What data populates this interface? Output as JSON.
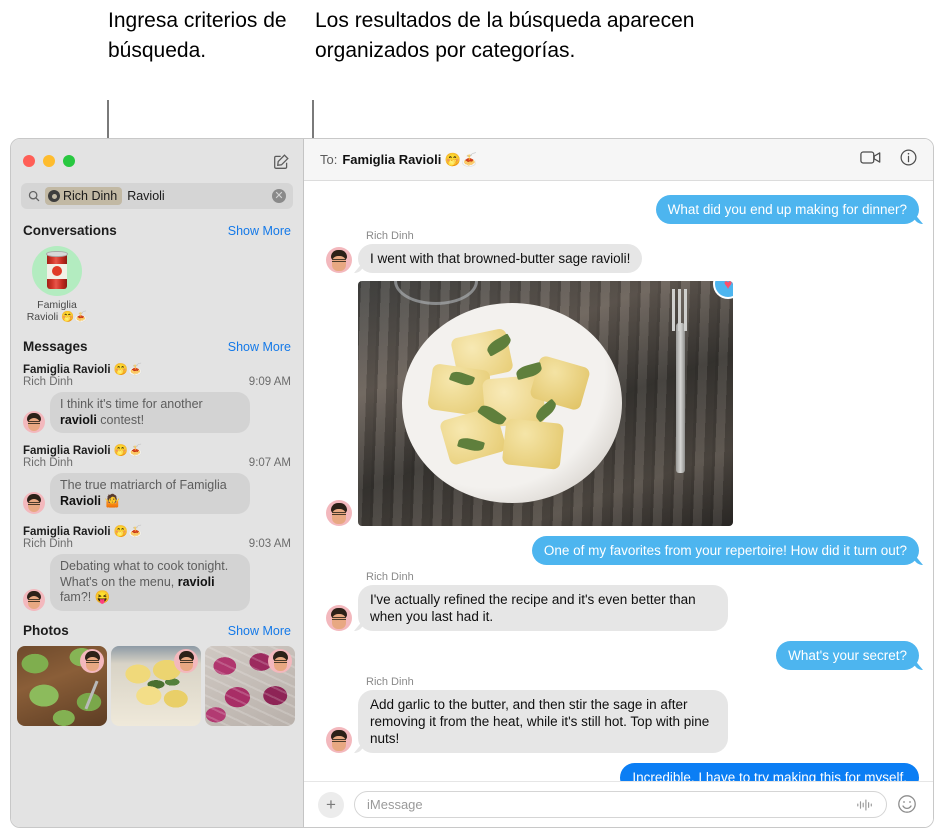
{
  "annotations": {
    "left": "Ingresa criterios de búsqueda.",
    "right": "Los resultados de la búsqueda aparecen organizados por categorías."
  },
  "sidebar": {
    "compose_icon": "compose-icon",
    "search": {
      "icon": "search-icon",
      "token_label": "Rich Dinh",
      "query_text": "Ravioli",
      "clear_icon": "clear-icon",
      "clear_glyph": "✕"
    },
    "sections": [
      {
        "title": "Conversations",
        "show_more": "Show More"
      },
      {
        "title": "Messages",
        "show_more": "Show More"
      },
      {
        "title": "Photos",
        "show_more": "Show More"
      }
    ],
    "conversations": [
      {
        "name": "Famiglia Ravioli 🤭🍝",
        "avatar_icon": "tomato-can-avatar"
      }
    ],
    "message_results": [
      {
        "chat": "Famiglia Ravioli 🤭🍝",
        "sender": "Rich Dinh",
        "time": "9:09 AM",
        "pre": "I think it's time for another ",
        "match": "ravioli",
        "post": " contest!"
      },
      {
        "chat": "Famiglia Ravioli 🤭🍝",
        "sender": "Rich Dinh",
        "time": "9:07 AM",
        "pre": "The true matriarch of Famiglia ",
        "match": "Ravioli",
        "post": " 🤷"
      },
      {
        "chat": "Famiglia Ravioli 🤭🍝",
        "sender": "Rich Dinh",
        "time": "9:03 AM",
        "pre": "Debating what to cook tonight. What's on the menu, ",
        "match": "ravioli",
        "post": " fam?! 😝"
      }
    ],
    "photos": [
      {
        "name": "spinach-ravioli-photo"
      },
      {
        "name": "sage-butter-ravioli-photo"
      },
      {
        "name": "beet-ravioli-photo"
      }
    ]
  },
  "conversation": {
    "to_label": "To:",
    "recipient": "Famiglia Ravioli 🤭🍝",
    "facetime_icon": "facetime-video-icon",
    "info_icon": "info-icon",
    "messages": [
      {
        "type": "outgoing",
        "text": "What did you end up making for dinner?",
        "style": "light"
      },
      {
        "type": "incoming",
        "sender": "Rich Dinh",
        "text": "I went with that browned-butter sage ravioli!"
      },
      {
        "type": "photo",
        "alt": "ravioli-with-sage-photo",
        "tapback": "heart-tapback"
      },
      {
        "type": "outgoing",
        "text": "One of my favorites from your repertoire! How did it turn out?",
        "style": "light"
      },
      {
        "type": "incoming",
        "sender": "Rich Dinh",
        "text": "I've actually refined the recipe and it's even better than when you last had it."
      },
      {
        "type": "outgoing",
        "text": "What's your secret?",
        "style": "light"
      },
      {
        "type": "incoming",
        "sender": "Rich Dinh",
        "text": "Add garlic to the butter, and then stir the sage in after removing it from the heat, while it's still hot. Top with pine nuts!"
      },
      {
        "type": "outgoing",
        "text": "Incredible. I have to try making this for myself.",
        "style": "strong"
      }
    ],
    "input": {
      "plus_icon": "plus-icon",
      "plus_glyph": "+",
      "placeholder": "iMessage",
      "audio_icon": "audio-waveform-icon",
      "emoji_icon": "emoji-icon"
    }
  },
  "colors": {
    "accent_blue": "#0b7ef4",
    "bubble_blue_light": "#4db5ef",
    "bubble_gray": "#e6e6e6",
    "link_blue": "#1479e8",
    "sidebar_bg": "#e3e3e3"
  }
}
